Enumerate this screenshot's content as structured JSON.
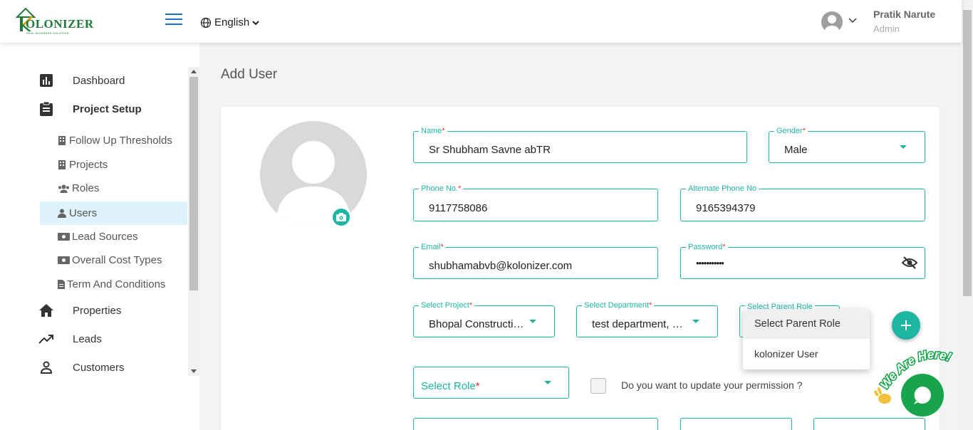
{
  "header": {
    "logo_text": "OLONIZER",
    "logo_sub": "REAL BUSINESS SOLUTION",
    "language": "English",
    "user_name": "Pratik Narute",
    "user_role": "Admin"
  },
  "sidebar": {
    "items": [
      {
        "label": "Dashboard",
        "icon": "bar-chart-icon"
      },
      {
        "label": "Project Setup",
        "icon": "clipboard-icon"
      },
      {
        "label": "Properties",
        "icon": "home-icon"
      },
      {
        "label": "Leads",
        "icon": "trending-up-icon"
      },
      {
        "label": "Customers",
        "icon": "person-icon"
      }
    ],
    "subitems": [
      {
        "label": "Follow Up Thresholds",
        "icon": "building-icon"
      },
      {
        "label": "Projects",
        "icon": "building-icon"
      },
      {
        "label": "Roles",
        "icon": "users-icon"
      },
      {
        "label": "Users",
        "icon": "user-tie-icon"
      },
      {
        "label": "Lead Sources",
        "icon": "money-icon"
      },
      {
        "label": "Overall Cost Types",
        "icon": "money-icon"
      },
      {
        "label": "Term And Conditions",
        "icon": "file-icon"
      }
    ]
  },
  "page": {
    "title": "Add User"
  },
  "form": {
    "name": {
      "label": "Name",
      "value": "Sr Shubham Savne abTR"
    },
    "gender": {
      "label": "Gender",
      "value": "Male"
    },
    "phone": {
      "label": "Phone No.",
      "value": "9117758086"
    },
    "alt_phone": {
      "label": "Alternate Phone No",
      "value": "9165394379"
    },
    "email": {
      "label": "Email",
      "value": "shubhamabvb@kolonizer.com"
    },
    "password": {
      "label": "Password",
      "value": "•••••••••••"
    },
    "project": {
      "label": "Select Project",
      "value": "Bhopal Construction, Bhopal"
    },
    "department": {
      "label": "Select Department",
      "value": "test department, marketing"
    },
    "parent_role": {
      "label": "Select Parent Role"
    },
    "role": {
      "placeholder": "Select Role"
    },
    "permission_label": "Do you want to update your permission ?",
    "required_mark": "*"
  },
  "parent_role_dropdown": {
    "options": [
      "Select Parent Role",
      "kolonizer User"
    ]
  },
  "chat": {
    "tag": "We Are Here!"
  },
  "colors": {
    "accent": "#1fb5a3",
    "required": "#e53935",
    "chat": "#17a44b",
    "active_nav": "#dff3fc"
  }
}
